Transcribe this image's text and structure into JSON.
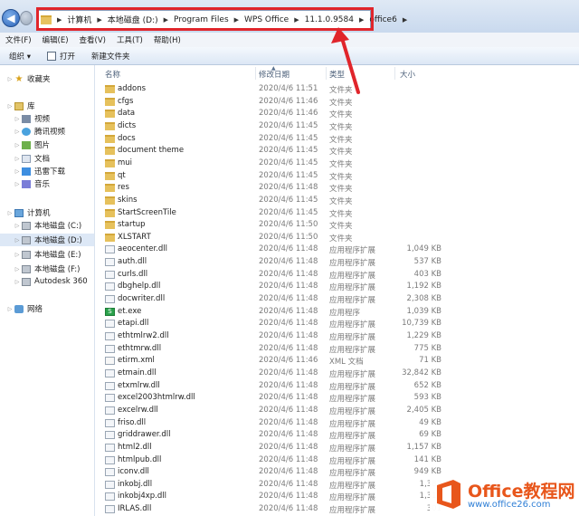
{
  "address_bar": {
    "crumbs": [
      "计算机",
      "本地磁盘 (D:)",
      "Program Files",
      "WPS Office",
      "11.1.0.9584",
      "office6"
    ],
    "highlight_color": "#e0252b"
  },
  "menu": [
    "文件(F)",
    "编辑(E)",
    "查看(V)",
    "工具(T)",
    "帮助(H)"
  ],
  "toolbar": {
    "organize": "组织 ▾",
    "open": "打开",
    "new_folder": "新建文件夹"
  },
  "nav": [
    {
      "label": "收藏夹",
      "icon": "star-icon"
    },
    {
      "label": "库",
      "icon": "library-icon"
    },
    {
      "label": "视频",
      "icon": "video-icon"
    },
    {
      "label": "腾讯视频",
      "icon": "tencent-video-icon"
    },
    {
      "label": "图片",
      "icon": "picture-icon"
    },
    {
      "label": "文档",
      "icon": "document-icon"
    },
    {
      "label": "迅雷下载",
      "icon": "download-icon"
    },
    {
      "label": "音乐",
      "icon": "music-icon"
    },
    {
      "label": "计算机",
      "icon": "computer-icon"
    },
    {
      "label": "本地磁盘 (C:)",
      "icon": "drive-icon"
    },
    {
      "label": "本地磁盘 (D:)",
      "icon": "drive-icon"
    },
    {
      "label": "本地磁盘 (E:)",
      "icon": "drive-icon"
    },
    {
      "label": "本地磁盘 (F:)",
      "icon": "drive-icon"
    },
    {
      "label": "Autodesk 360",
      "icon": "cloud-icon"
    },
    {
      "label": "网络",
      "icon": "network-icon"
    }
  ],
  "columns": {
    "name": "名称",
    "date": "修改日期",
    "type": "类型",
    "size": "大小"
  },
  "files": [
    {
      "name": "addons",
      "date": "2020/4/6 11:51",
      "type": "文件夹",
      "size": "",
      "kind": "folder"
    },
    {
      "name": "cfgs",
      "date": "2020/4/6 11:46",
      "type": "文件夹",
      "size": "",
      "kind": "folder"
    },
    {
      "name": "data",
      "date": "2020/4/6 11:46",
      "type": "文件夹",
      "size": "",
      "kind": "folder"
    },
    {
      "name": "dicts",
      "date": "2020/4/6 11:45",
      "type": "文件夹",
      "size": "",
      "kind": "folder"
    },
    {
      "name": "docs",
      "date": "2020/4/6 11:45",
      "type": "文件夹",
      "size": "",
      "kind": "folder"
    },
    {
      "name": "document theme",
      "date": "2020/4/6 11:45",
      "type": "文件夹",
      "size": "",
      "kind": "folder"
    },
    {
      "name": "mui",
      "date": "2020/4/6 11:45",
      "type": "文件夹",
      "size": "",
      "kind": "folder"
    },
    {
      "name": "qt",
      "date": "2020/4/6 11:45",
      "type": "文件夹",
      "size": "",
      "kind": "folder"
    },
    {
      "name": "res",
      "date": "2020/4/6 11:48",
      "type": "文件夹",
      "size": "",
      "kind": "folder"
    },
    {
      "name": "skins",
      "date": "2020/4/6 11:45",
      "type": "文件夹",
      "size": "",
      "kind": "folder"
    },
    {
      "name": "StartScreenTile",
      "date": "2020/4/6 11:45",
      "type": "文件夹",
      "size": "",
      "kind": "folder"
    },
    {
      "name": "startup",
      "date": "2020/4/6 11:50",
      "type": "文件夹",
      "size": "",
      "kind": "folder"
    },
    {
      "name": "XLSTART",
      "date": "2020/4/6 11:50",
      "type": "文件夹",
      "size": "",
      "kind": "folder"
    },
    {
      "name": "aeocenter.dll",
      "date": "2020/4/6 11:48",
      "type": "应用程序扩展",
      "size": "1,049 KB",
      "kind": "dll"
    },
    {
      "name": "auth.dll",
      "date": "2020/4/6 11:48",
      "type": "应用程序扩展",
      "size": "537 KB",
      "kind": "dll"
    },
    {
      "name": "curls.dll",
      "date": "2020/4/6 11:48",
      "type": "应用程序扩展",
      "size": "403 KB",
      "kind": "dll"
    },
    {
      "name": "dbghelp.dll",
      "date": "2020/4/6 11:48",
      "type": "应用程序扩展",
      "size": "1,192 KB",
      "kind": "dll"
    },
    {
      "name": "docwriter.dll",
      "date": "2020/4/6 11:48",
      "type": "应用程序扩展",
      "size": "2,308 KB",
      "kind": "dll"
    },
    {
      "name": "et.exe",
      "date": "2020/4/6 11:48",
      "type": "应用程序",
      "size": "1,039 KB",
      "kind": "exe"
    },
    {
      "name": "etapi.dll",
      "date": "2020/4/6 11:48",
      "type": "应用程序扩展",
      "size": "10,739 KB",
      "kind": "dll"
    },
    {
      "name": "ethtmlrw2.dll",
      "date": "2020/4/6 11:48",
      "type": "应用程序扩展",
      "size": "1,229 KB",
      "kind": "dll"
    },
    {
      "name": "ethtmrw.dll",
      "date": "2020/4/6 11:48",
      "type": "应用程序扩展",
      "size": "775 KB",
      "kind": "dll"
    },
    {
      "name": "etirm.xml",
      "date": "2020/4/6 11:46",
      "type": "XML 文档",
      "size": "71 KB",
      "kind": "xml"
    },
    {
      "name": "etmain.dll",
      "date": "2020/4/6 11:48",
      "type": "应用程序扩展",
      "size": "32,842 KB",
      "kind": "dll"
    },
    {
      "name": "etxmlrw.dll",
      "date": "2020/4/6 11:48",
      "type": "应用程序扩展",
      "size": "652 KB",
      "kind": "dll"
    },
    {
      "name": "excel2003htmlrw.dll",
      "date": "2020/4/6 11:48",
      "type": "应用程序扩展",
      "size": "593 KB",
      "kind": "dll"
    },
    {
      "name": "excelrw.dll",
      "date": "2020/4/6 11:48",
      "type": "应用程序扩展",
      "size": "2,405 KB",
      "kind": "dll"
    },
    {
      "name": "friso.dll",
      "date": "2020/4/6 11:48",
      "type": "应用程序扩展",
      "size": "49 KB",
      "kind": "dll"
    },
    {
      "name": "griddrawer.dll",
      "date": "2020/4/6 11:48",
      "type": "应用程序扩展",
      "size": "69 KB",
      "kind": "dll"
    },
    {
      "name": "html2.dll",
      "date": "2020/4/6 11:48",
      "type": "应用程序扩展",
      "size": "1,157 KB",
      "kind": "dll"
    },
    {
      "name": "htmlpub.dll",
      "date": "2020/4/6 11:48",
      "type": "应用程序扩展",
      "size": "141 KB",
      "kind": "dll"
    },
    {
      "name": "iconv.dll",
      "date": "2020/4/6 11:48",
      "type": "应用程序扩展",
      "size": "949 KB",
      "kind": "dll"
    },
    {
      "name": "inkobj.dll",
      "date": "2020/4/6 11:48",
      "type": "应用程序扩展",
      "size": "1,382",
      "kind": "dll"
    },
    {
      "name": "inkobj4xp.dll",
      "date": "2020/4/6 11:48",
      "type": "应用程序扩展",
      "size": "1,312",
      "kind": "dll"
    },
    {
      "name": "IRLAS.dll",
      "date": "2020/4/6 11:48",
      "type": "应用程序扩展",
      "size": "301",
      "kind": "dll"
    }
  ],
  "watermark": {
    "title": "Office教程网",
    "url": "www.office26.com"
  }
}
